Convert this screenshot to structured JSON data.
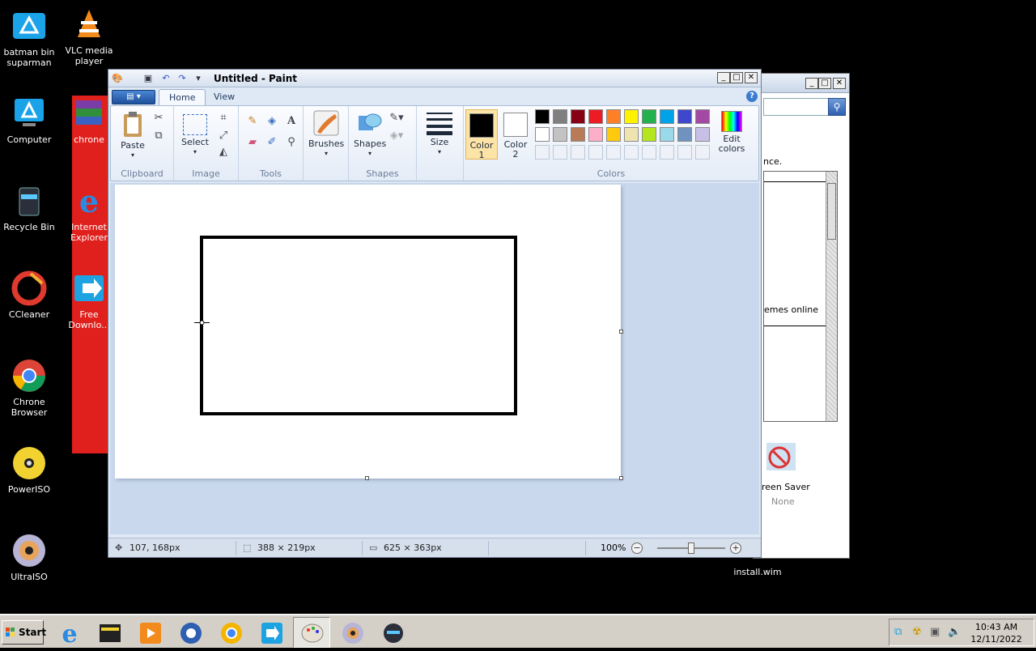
{
  "desktop": {
    "icons": [
      {
        "label": "batman bin suparman"
      },
      {
        "label": "VLC media player"
      },
      {
        "label": "Computer"
      },
      {
        "label": "chrone"
      },
      {
        "label": "Recycle Bin"
      },
      {
        "label": "Internet Explorer"
      },
      {
        "label": "CCleaner"
      },
      {
        "label": "Free Downlo..."
      },
      {
        "label": "Chrone Browser"
      },
      {
        "label": "PowerISO"
      },
      {
        "label": "UltraISO"
      },
      {
        "label": "install.wim"
      }
    ]
  },
  "bg_window": {
    "text_ance": "nce.",
    "text_themes": "emes online",
    "screen_saver_label": "reen Saver",
    "screen_saver_value": "None"
  },
  "paint": {
    "title": "Untitled - Paint",
    "tabs": [
      "Home",
      "View"
    ],
    "groups": {
      "clipboard": {
        "label": "Clipboard",
        "paste": "Paste"
      },
      "image": {
        "label": "Image",
        "select": "Select"
      },
      "tools": {
        "label": "Tools"
      },
      "brushes": {
        "label": "Brushes"
      },
      "shapes": {
        "label": "Shapes",
        "shapes_btn": "Shapes"
      },
      "size": {
        "label": "Size"
      },
      "colors": {
        "label": "Colors",
        "color1": "Color\n1",
        "color1_line1": "Color",
        "color1_line2": "1",
        "color2_line1": "Color",
        "color2_line2": "2",
        "edit_line1": "Edit",
        "edit_line2": "colors",
        "color1_value": "#000000",
        "color2_value": "#ffffff",
        "palette_row1": [
          "#000000",
          "#7f7f7f",
          "#880015",
          "#ed1c24",
          "#ff7f27",
          "#fff200",
          "#22b14c",
          "#00a2e8",
          "#3f48cc",
          "#a349a4"
        ],
        "palette_row2": [
          "#ffffff",
          "#c3c3c3",
          "#b97a57",
          "#ffaec9",
          "#ffc90e",
          "#efe4b0",
          "#b5e61d",
          "#99d9ea",
          "#7092be",
          "#c8bfe7"
        ]
      }
    },
    "status": {
      "cursor_pos": "107, 168px",
      "selection_size": "388 × 219px",
      "canvas_size": "625 × 363px",
      "zoom": "100%"
    }
  },
  "taskbar": {
    "start_label": "Start",
    "time": "10:43 AM",
    "date": "12/11/2022"
  }
}
